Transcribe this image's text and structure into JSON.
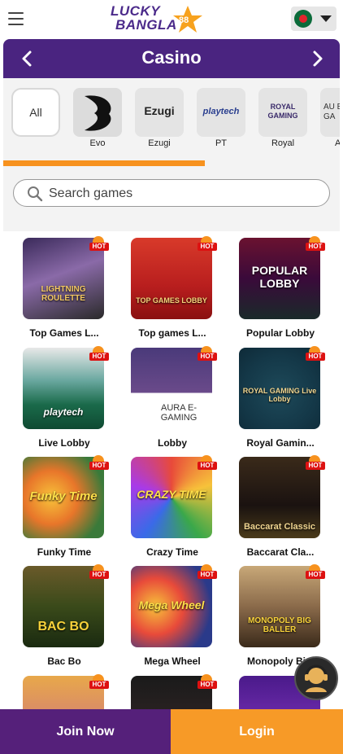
{
  "header": {
    "logo_line1": "LUCKY",
    "logo_line2": "BANGLA",
    "logo_num": "88",
    "language_icon": "bangladesh-flag-icon"
  },
  "section": {
    "title": "Casino"
  },
  "providers": {
    "all_label": "All",
    "items": [
      {
        "label": "Evo"
      },
      {
        "label": "Ezugi",
        "logo_text": "Ezugi"
      },
      {
        "label": "PT",
        "logo_text": "playtech"
      },
      {
        "label": "Royal",
        "logo_text": "ROYAL GAMING"
      },
      {
        "label": "A",
        "logo_text": "AU E-GA"
      }
    ],
    "scroll_progress": 0.6
  },
  "search": {
    "placeholder": "Search games"
  },
  "games": [
    {
      "name": "Top Games L...",
      "thumb_text": "LIGHTNING ROULETTE"
    },
    {
      "name": "Top games L...",
      "thumb_text": "TOP GAMES LOBBY"
    },
    {
      "name": "Popular Lobby",
      "thumb_text": "POPULAR LOBBY"
    },
    {
      "name": "Live Lobby",
      "thumb_text": "playtech"
    },
    {
      "name": "Lobby",
      "thumb_text": "AURA E-GAMING"
    },
    {
      "name": "Royal Gamin...",
      "thumb_text": "ROYAL GAMING Live Lobby"
    },
    {
      "name": "Funky Time",
      "thumb_text": "Funky Time"
    },
    {
      "name": "Crazy Time",
      "thumb_text": "CRAZY TIME"
    },
    {
      "name": "Baccarat Cla...",
      "thumb_text": "Baccarat Classic"
    },
    {
      "name": "Bac Bo",
      "thumb_text": "BAC BO"
    },
    {
      "name": "Mega Wheel",
      "thumb_text": "Mega Wheel"
    },
    {
      "name": "Monopoly Bi...",
      "thumb_text": "MONOPOLY BIG BALLER"
    },
    {
      "name": "",
      "thumb_text": ""
    },
    {
      "name": "",
      "thumb_text": ""
    },
    {
      "name": "",
      "thumb_text": ""
    }
  ],
  "hot_label": "HOT",
  "bottom": {
    "join_label": "Join Now",
    "login_label": "Login"
  },
  "colors": {
    "primary": "#4a2480",
    "accent": "#f7921e",
    "hot": "#dd1111"
  }
}
